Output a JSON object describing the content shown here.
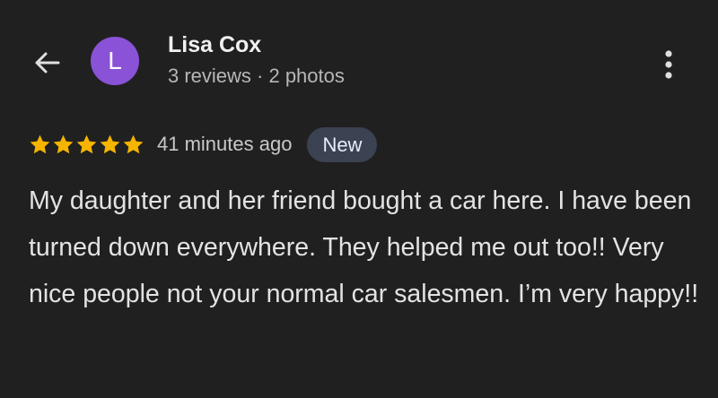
{
  "header": {
    "back_icon": "arrow-left-icon",
    "menu_icon": "more-vert-icon"
  },
  "reviewer": {
    "avatar_initial": "L",
    "avatar_color": "#8a52d6",
    "name": "Lisa Cox",
    "meta": "3 reviews · 2 photos"
  },
  "review": {
    "rating": 5,
    "max_rating": 5,
    "star_color": "#f5b400",
    "time_ago": "41 minutes ago",
    "badge": "New",
    "text": "My daughter and her friend bought a car here. I have been turned down everywhere. They helped me out too!! Very nice people not your normal car salesmen. I’m very happy!!"
  },
  "colors": {
    "background": "#202020",
    "primary_text": "#f1f1f1",
    "secondary_text": "#b7b7b7",
    "badge_background": "#3b4252"
  }
}
